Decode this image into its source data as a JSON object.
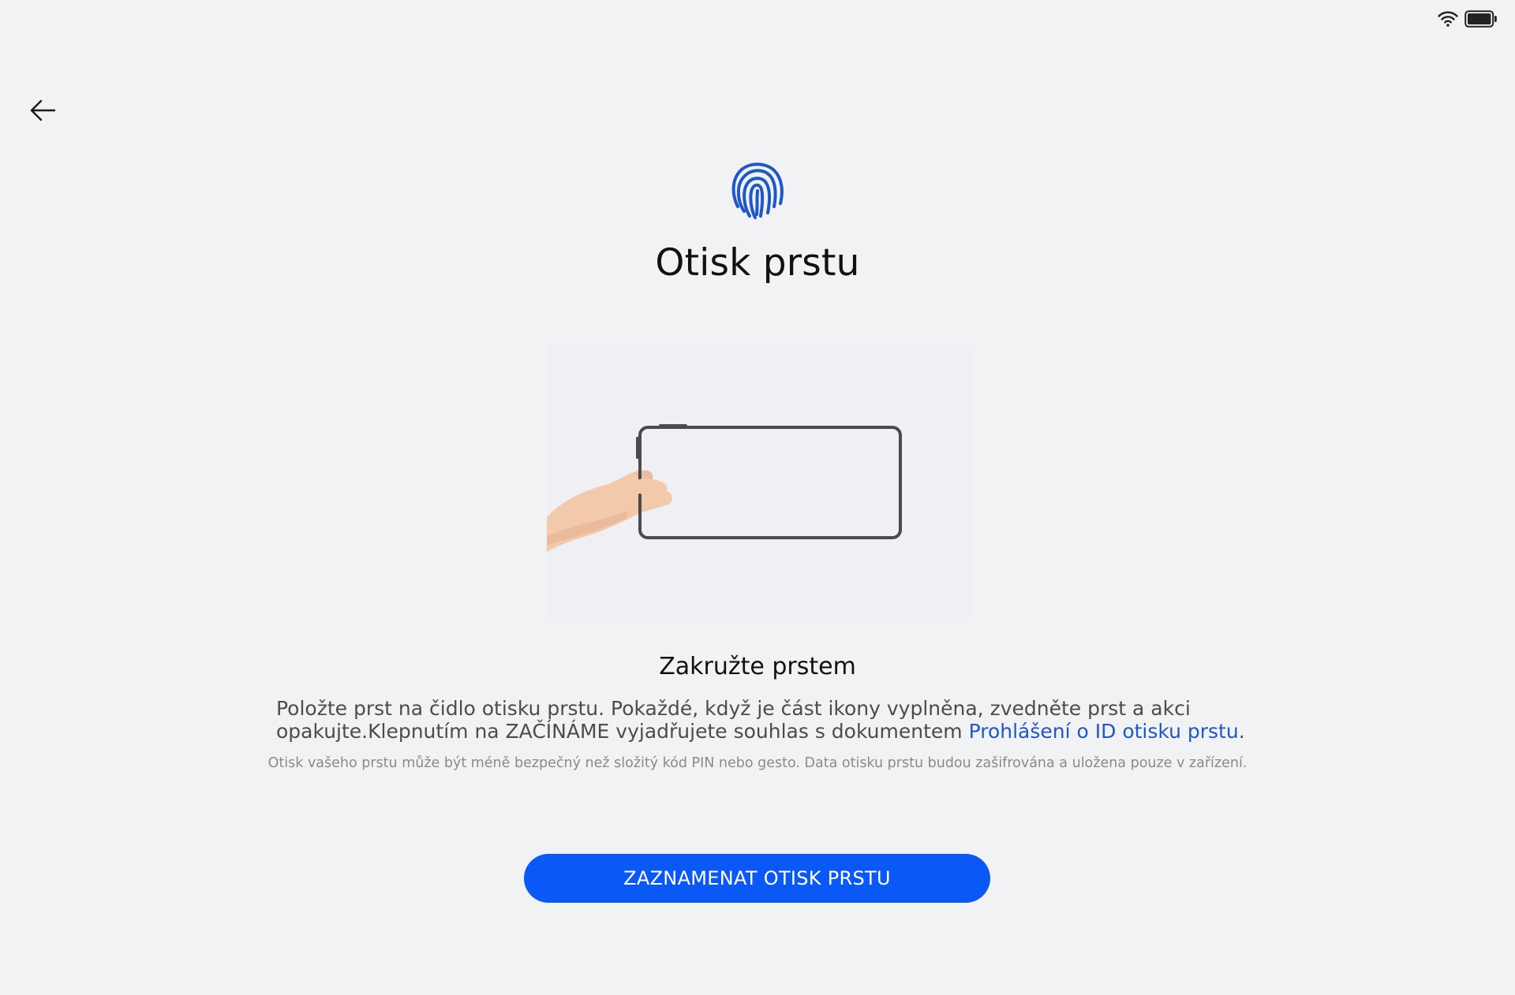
{
  "status_bar": {
    "wifi_icon": "wifi-icon",
    "battery_icon": "battery-icon"
  },
  "navigation": {
    "back_icon": "arrow-left-icon"
  },
  "header": {
    "icon": "fingerprint-icon",
    "title": "Otisk prstu"
  },
  "illustration": {
    "description_icon": "hand-holding-tablet-illustration"
  },
  "instructions": {
    "title": "Zakružte prstem",
    "body_text": "Položte prst na čidlo otisku prstu. Pokaždé, když je část ikony vyplněna, zvedněte prst a akci opakujte.Klepnutím na ZAČÍNÁME vyjadřujete souhlas s dokumentem ",
    "link_text": "Prohlášení o ID otisku prstu",
    "body_suffix": "."
  },
  "security_note": "Otisk vašeho prstu může být méně bezpečný než složitý kód PIN nebo gesto. Data otisku prstu budou zašifrována a uložena pouze v zařízení.",
  "primary_action": {
    "label": "ZAZNAMENAT OTISK PRSTU"
  },
  "colors": {
    "accent": "#0a59f7",
    "link": "#1f57c7",
    "background": "#f1f2f4",
    "fingerprint": "#1f57c7"
  }
}
